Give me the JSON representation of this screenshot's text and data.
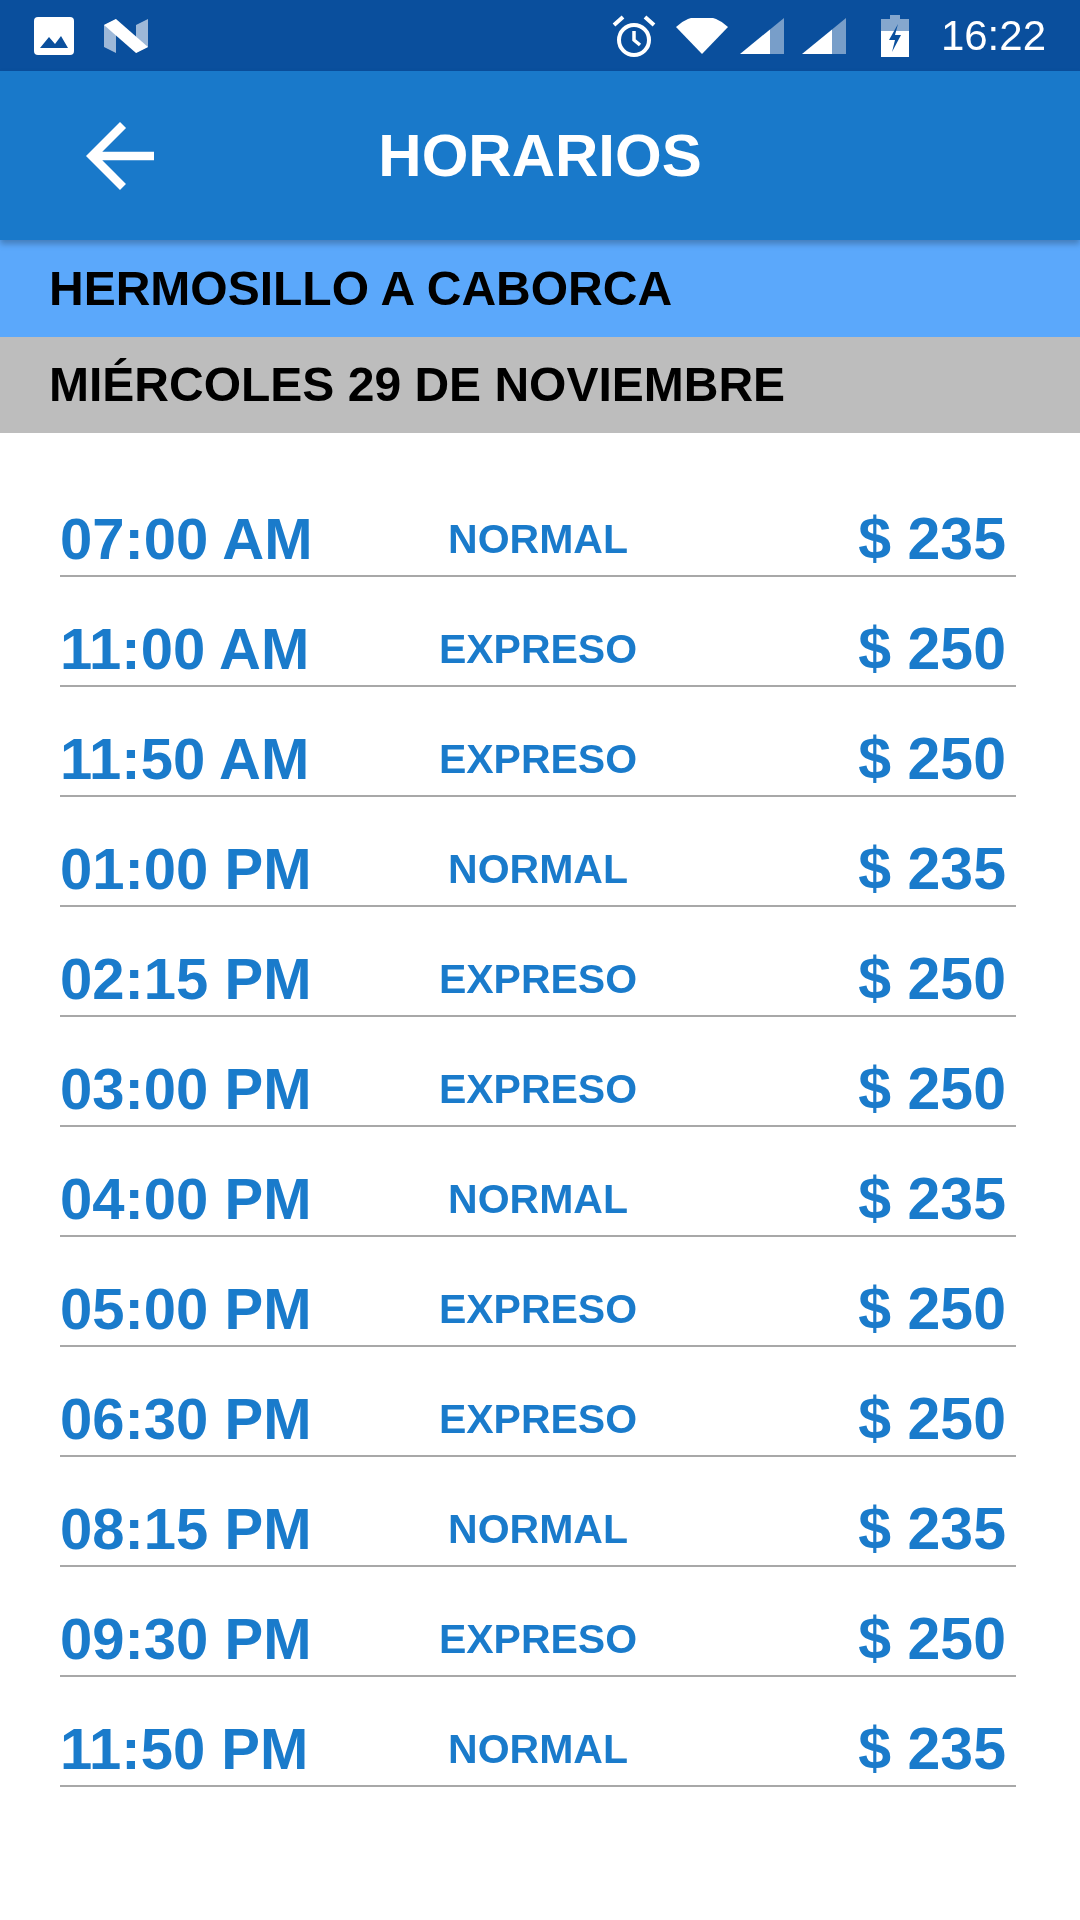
{
  "status_bar": {
    "time": "16:22"
  },
  "app_bar": {
    "title": "HORARIOS"
  },
  "route": "HERMOSILLO A CABORCA",
  "date": "MIÉRCOLES 29 DE NOVIEMBRE",
  "schedules": [
    {
      "time": "07:00 AM",
      "service": "NORMAL",
      "price": "$ 235"
    },
    {
      "time": "11:00 AM",
      "service": "EXPRESO",
      "price": "$ 250"
    },
    {
      "time": "11:50 AM",
      "service": "EXPRESO",
      "price": "$ 250"
    },
    {
      "time": "01:00 PM",
      "service": "NORMAL",
      "price": "$ 235"
    },
    {
      "time": "02:15 PM",
      "service": "EXPRESO",
      "price": "$ 250"
    },
    {
      "time": "03:00 PM",
      "service": "EXPRESO",
      "price": "$ 250"
    },
    {
      "time": "04:00 PM",
      "service": "NORMAL",
      "price": "$ 235"
    },
    {
      "time": "05:00 PM",
      "service": "EXPRESO",
      "price": "$ 250"
    },
    {
      "time": "06:30 PM",
      "service": "EXPRESO",
      "price": "$ 250"
    },
    {
      "time": "08:15 PM",
      "service": "NORMAL",
      "price": "$ 235"
    },
    {
      "time": "09:30 PM",
      "service": "EXPRESO",
      "price": "$ 250"
    },
    {
      "time": "11:50 PM",
      "service": "NORMAL",
      "price": "$ 235"
    }
  ]
}
